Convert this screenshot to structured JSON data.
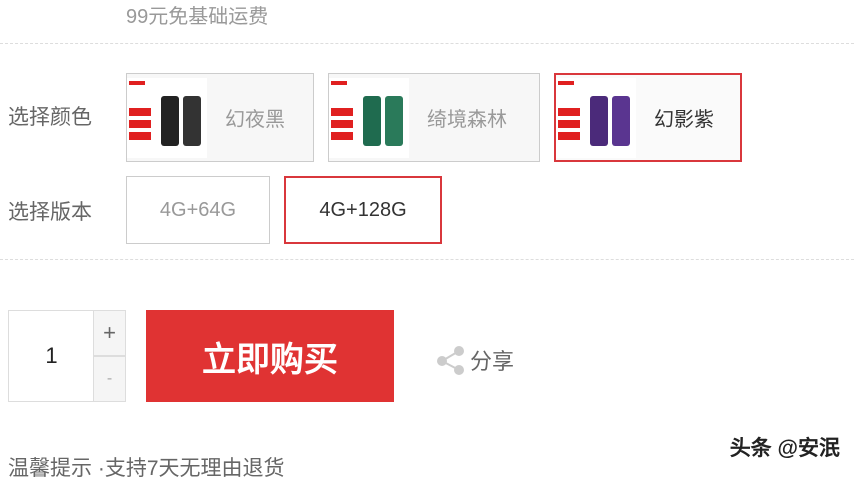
{
  "shipping_note": "99元免基础运费",
  "color": {
    "label": "选择颜色",
    "options": [
      {
        "name": "幻夜黑",
        "selected": false,
        "phone_color": "#2a2a2a"
      },
      {
        "name": "绮境森林",
        "selected": false,
        "phone_color": "#1f6b4f"
      },
      {
        "name": "幻影紫",
        "selected": true,
        "phone_color": "#4b2a7a"
      }
    ]
  },
  "version": {
    "label": "选择版本",
    "options": [
      {
        "name": "4G+64G",
        "selected": false
      },
      {
        "name": "4G+128G",
        "selected": true
      }
    ]
  },
  "purchase": {
    "quantity": "1",
    "plus": "+",
    "minus": "-",
    "buy_label": "立即购买",
    "share_label": "分享"
  },
  "tip": "温馨提示   ·支持7天无理由退货",
  "watermark": "头条 @安泯",
  "colors": {
    "accent": "#e03333",
    "selected_border": "#d9373c"
  }
}
